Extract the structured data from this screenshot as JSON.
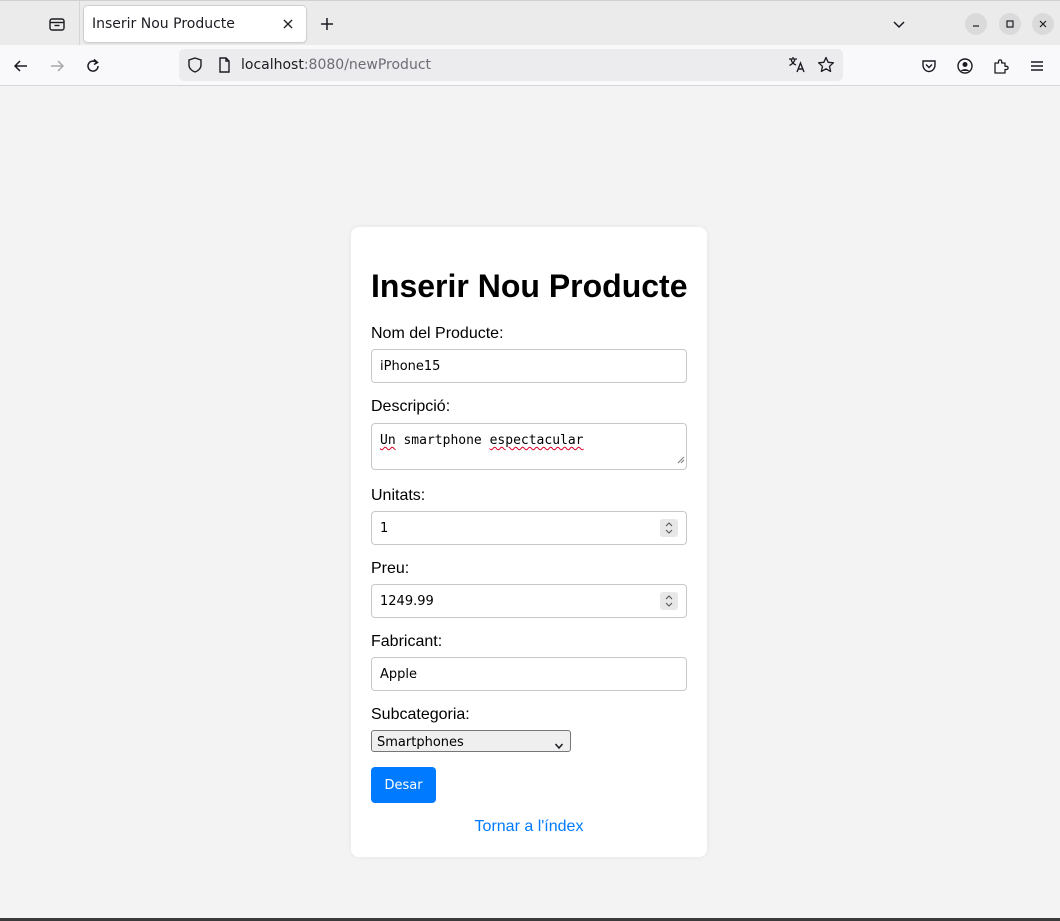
{
  "browser": {
    "tab_title": "Inserir Nou Producte",
    "url_host": "localhost",
    "url_rest": ":8080/newProduct"
  },
  "form": {
    "title": "Inserir Nou Producte",
    "name_label": "Nom del Producte:",
    "name_value": "iPhone15",
    "desc_label": "Descripció:",
    "desc_word1": "Un",
    "desc_word2": "smartphone",
    "desc_word3": "espectacular",
    "units_label": "Unitats:",
    "units_value": "1",
    "price_label": "Preu:",
    "price_value": "1249.99",
    "maker_label": "Fabricant:",
    "maker_value": "Apple",
    "subcat_label": "Subcategoria:",
    "subcat_value": "Smartphones",
    "save_label": "Desar",
    "back_link": "Tornar a l'índex"
  },
  "icons": {
    "tab_list": "tab-list-icon",
    "close": "close-icon",
    "new_tab": "plus-icon",
    "list_all_tabs": "chevron-down-icon",
    "back": "arrow-left-icon",
    "forward": "arrow-right-icon",
    "reload": "reload-icon",
    "shield": "shield-icon",
    "page": "page-icon",
    "translate": "translate-icon",
    "bookmark": "star-icon",
    "pocket": "pocket-icon",
    "account": "account-icon",
    "extensions": "puzzle-icon",
    "menu": "hamburger-icon"
  },
  "colors": {
    "primary": "#007bff",
    "page_bg": "#f3f3f3",
    "spell_error": "#d70022"
  }
}
